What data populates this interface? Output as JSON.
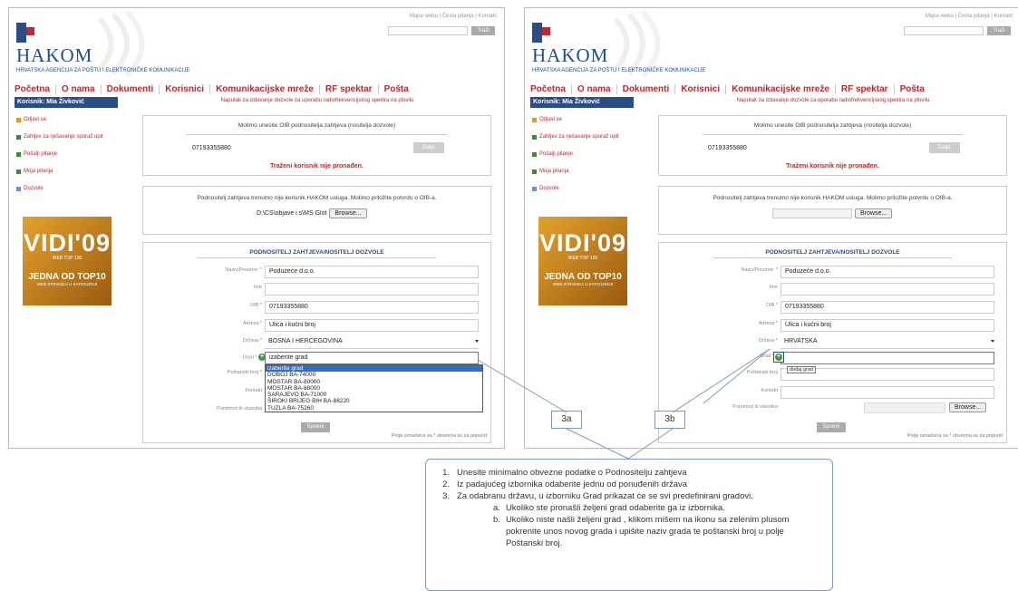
{
  "panels": [
    {
      "id": "a",
      "top_links": "Mapa weba | Česta pitanja | Kontakt",
      "search_button": "Traži",
      "brand": {
        "name": "HAKOM",
        "subtitle": "HRVATSKA AGENCIJA ZA POŠTU I ELEKTRONIČKE KOMUNIKACIJE"
      },
      "nav": [
        "Početna",
        "O nama",
        "Dokumenti",
        "Korisnici",
        "Komunikacijske mreže",
        "RF spektar",
        "Pošta"
      ],
      "user": "Korisnik: Mia Živković",
      "notice": "Naputak za izdavanje dozvole za uporabu radiofrekvencijskog spektra na plovilu",
      "sidebar": [
        "Odjavi se",
        "Zahtjev za rješavanje sporaž upit",
        "Pošalji pitanje",
        "Moja pitanja",
        "Dozvole"
      ],
      "ad": {
        "big": "VIDI'09",
        "tag": "WEB TOP 100",
        "line1": "JEDNA OD TOP10",
        "line2": "WEB STRANICA U KATEGORIJI"
      },
      "oib_box": {
        "title": "Molimo unesite OIB podnositelja zahtjeva (nositelja dozvole)",
        "value": "07193355880",
        "button": "Dalje",
        "error": "Traženi korisnik nije pronađen."
      },
      "upload_box": {
        "message": "Podnositelj zahtjeva trenutno nije korisnik HAKOM usluga. Molimo priložite potvrdu o OIB-a.",
        "path": "D:\\CS\\objave i s\\MS Glot",
        "browse": "Browse..."
      },
      "form": {
        "title": "PODNOSITELJ ZAHTJEVA/NOSITELJ DOZVOLE",
        "labels": {
          "naziv": "Naziv/Prezime: *",
          "ime": "Ime",
          "oib": "OIB *",
          "adresa": "Adresa *",
          "drzava": "Država *",
          "grad": "Grad *",
          "postanski": "Poštanski broj *",
          "kontakt": "Kontakt",
          "punomoc": "Punomoć ili vlasnika"
        },
        "values": {
          "naziv": "Poduzeće d.o.o.",
          "oib": "07193355880",
          "adresa": "Ulica i kućni broj",
          "drzava": "BOSNA I HERCEGOVINA",
          "grad": "izaberite grad"
        },
        "dropdown": [
          "izaberite grad",
          "DOBOJ BA-74000",
          "MOSTAR BA-80000",
          "MOSTAR BA-88000",
          "SARAJEVO BA-71000",
          "ŠIROKI BRIJEG BIH BA-88220",
          "TUZLA BA-75260"
        ],
        "submit": "Spremi",
        "footer": "Polja označena sa * obvezna su za popunit"
      }
    },
    {
      "id": "b",
      "top_links": "Mapa weba | Česta pitanja | Kontakt",
      "search_button": "Traži",
      "brand": {
        "name": "HAKOM",
        "subtitle": "HRVATSKA AGENCIJA ZA POŠTU I ELEKTRONIČKE KOMUNIKACIJE"
      },
      "nav": [
        "Početna",
        "O nama",
        "Dokumenti",
        "Korisnici",
        "Komunikacijske mreže",
        "RF spektar",
        "Pošta"
      ],
      "user": "Korisnik: Mia Živković",
      "notice": "Naputak za izdavanje dozvole za uporabu radiofrekvencijskog spektra na plovilu",
      "sidebar": [
        "Odjavi se",
        "Zahtjev za rješavanje sporaž upit",
        "Pošalji pitanje",
        "Moja pitanja",
        "Dozvole"
      ],
      "ad": {
        "big": "VIDI'09",
        "tag": "WEB TOP 100",
        "line1": "JEDNA OD TOP10",
        "line2": "WEB STRANICA U KATEGORIJI"
      },
      "oib_box": {
        "title": "Molimo unesite OIB podnositelja zahtjeva (nositelja dozvole)",
        "value": "07193355880",
        "button": "Dalje",
        "error": "Traženi korisnik nije pronađen."
      },
      "upload_box": {
        "message": "Podnositelj zahtjeva trenutno nije korisnik HAKOM usluga. Molimo priložite potvrdu o OIB-a.",
        "browse": "Browse..."
      },
      "form": {
        "title": "PODNOSITELJ ZAHTJEVA/NOSITELJ DOZVOLE",
        "labels": {
          "naziv": "Naziv/Prezime: *",
          "ime": "Ime",
          "oib": "OIB *",
          "adresa": "Adresa *",
          "drzava": "Država *",
          "grad": "Grad *",
          "postanski": "Poštanski broj",
          "kontakt": "Kontakt",
          "punomoc": "Punomoć ili vlasnika"
        },
        "values": {
          "naziv": "Poduzeće d.o.o.",
          "oib": "07193355880",
          "adresa": "Ulica i kućni broj",
          "drzava": "HRVATSKA"
        },
        "tooltip": "dodaj grad",
        "browse": "Browse...",
        "submit": "Spremi",
        "footer": "Polja označena sa * obvezna su za popunit"
      }
    }
  ],
  "callouts": {
    "a": "3a",
    "b": "3b"
  },
  "instructions": {
    "items": [
      {
        "n": "1.",
        "text": "Unesite minimalno obvezne podatke o Podnositelju zahtjeva"
      },
      {
        "n": "2.",
        "text": "Iz padajućeg izbornika odaberite jednu od ponuđenih država"
      },
      {
        "n": "3.",
        "text": "Za odabranu državu, u izborniku Grad prikazat će se svi predefinirani gradovi."
      }
    ],
    "sub": [
      {
        "n": "a.",
        "text": "Ukoliko ste pronašli željeni grad odaberite ga iz izbornika."
      },
      {
        "n": "b.",
        "text": "Ukoliko niste našli željeni grad , klikom mišem na ikonu sa zelenim plusom pokrenite unos novog grada i upišite naziv grada te poštanski broj u polje Poštanski broj."
      }
    ]
  },
  "colors": {
    "brand_red": "#c0282d",
    "brand_blue": "#2b4c86",
    "callout_line": "#7e98bf",
    "plus_green": "#3a9a3a",
    "select_highlight": "#2f6fc9"
  }
}
